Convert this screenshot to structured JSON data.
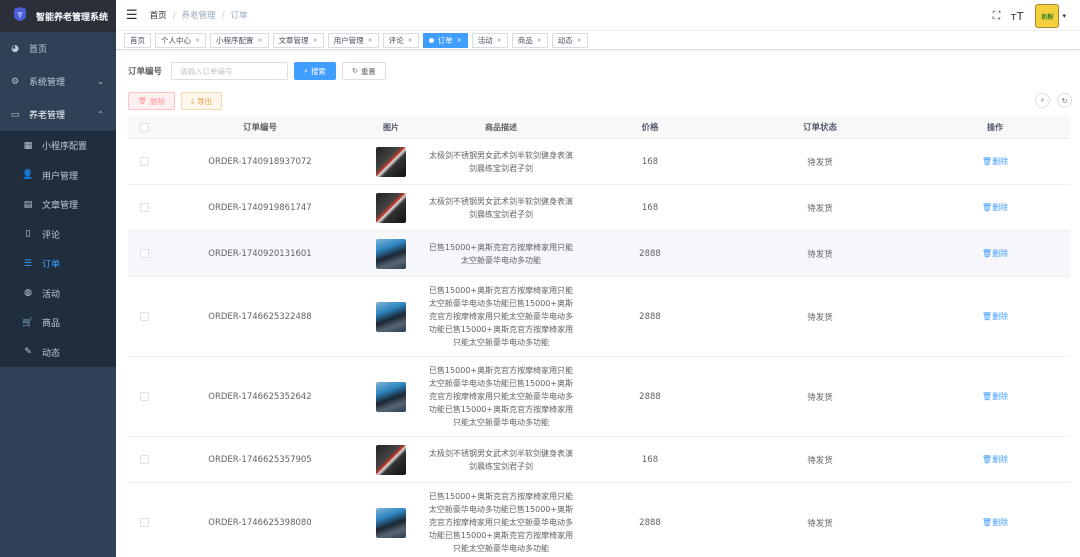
{
  "app": {
    "title": "智能养老管理系统",
    "logo_icon": "app-logo-icon"
  },
  "sidebar": {
    "items": [
      {
        "label": "首页",
        "icon": "dashboard-icon"
      },
      {
        "label": "系统管理",
        "icon": "gear-icon"
      },
      {
        "label": "养老管理",
        "icon": "monitor-icon"
      }
    ],
    "subitems": [
      {
        "label": "小程序配置",
        "icon": "grid-icon"
      },
      {
        "label": "用户管理",
        "icon": "user-icon"
      },
      {
        "label": "文章管理",
        "icon": "document-icon"
      },
      {
        "label": "评论",
        "icon": "book-icon"
      },
      {
        "label": "订单",
        "icon": "list-icon"
      },
      {
        "label": "活动",
        "icon": "globe-icon"
      },
      {
        "label": "商品",
        "icon": "cart-icon"
      },
      {
        "label": "动态",
        "icon": "edit-icon"
      }
    ]
  },
  "navbar": {
    "breadcrumb": [
      "首页",
      "养老管理",
      "订单"
    ],
    "avatar_text": "奶粉"
  },
  "tags": [
    {
      "label": "首页"
    },
    {
      "label": "个人中心"
    },
    {
      "label": "小程序配置"
    },
    {
      "label": "文章管理"
    },
    {
      "label": "用户管理"
    },
    {
      "label": "评论"
    },
    {
      "label": "订单"
    },
    {
      "label": "活动"
    },
    {
      "label": "商品"
    },
    {
      "label": "动态"
    }
  ],
  "search": {
    "label": "订单编号",
    "placeholder": "请输入订单编号",
    "search_btn": "搜索",
    "reset_btn": "重置"
  },
  "toolbar": {
    "delete_btn": "删除",
    "export_btn": "导出"
  },
  "table": {
    "headers": [
      "订单编号",
      "图片",
      "商品描述",
      "价格",
      "订单状态",
      "操作"
    ],
    "delete_label": "删除",
    "rows": [
      {
        "order_no": "ORDER-1740918937072",
        "image": "sword",
        "desc": "太极剑不锈钢男女武术剑半软剑健身表演剑晨练宝剑君子剑",
        "price": "168",
        "status": "待发货"
      },
      {
        "order_no": "ORDER-1740919861747",
        "image": "sword",
        "desc": "太极剑不锈钢男女武术剑半软剑健身表演剑晨练宝剑君子剑",
        "price": "168",
        "status": "待发货"
      },
      {
        "order_no": "ORDER-1740920131601",
        "image": "chair",
        "desc": "已售15000+奥斯克官方按摩椅家用只能太空舱豪华电动多功能",
        "price": "2888",
        "status": "待发货"
      },
      {
        "order_no": "ORDER-1746625322488",
        "image": "chair",
        "desc": "已售15000+奥斯克官方按摩椅家用只能太空舱豪华电动多功能已售15000+奥斯克官方按摩椅家用只能太空舱豪华电动多功能已售15000+奥斯克官方按摩椅家用只能太空舱豪华电动多功能",
        "price": "2888",
        "status": "待发货"
      },
      {
        "order_no": "ORDER-1746625352642",
        "image": "chair",
        "desc": "已售15000+奥斯克官方按摩椅家用只能太空舱豪华电动多功能已售15000+奥斯克官方按摩椅家用只能太空舱豪华电动多功能已售15000+奥斯克官方按摩椅家用只能太空舱豪华电动多功能",
        "price": "2888",
        "status": "待发货"
      },
      {
        "order_no": "ORDER-1746625357905",
        "image": "sword",
        "desc": "太极剑不锈钢男女武术剑半软剑健身表演剑晨练宝剑君子剑",
        "price": "168",
        "status": "待发货"
      },
      {
        "order_no": "ORDER-1746625398080",
        "image": "chair",
        "desc": "已售15000+奥斯克官方按摩椅家用只能太空舱豪华电动多功能已售15000+奥斯克官方按摩椅家用只能太空舱豪华电动多功能已售15000+奥斯克官方按摩椅家用只能太空舱豪华电动多功能",
        "price": "2888",
        "status": "待发货"
      }
    ]
  },
  "colors": {
    "sidebar_bg": "#304156",
    "accent": "#409eff",
    "active_menu": "#409eff"
  }
}
